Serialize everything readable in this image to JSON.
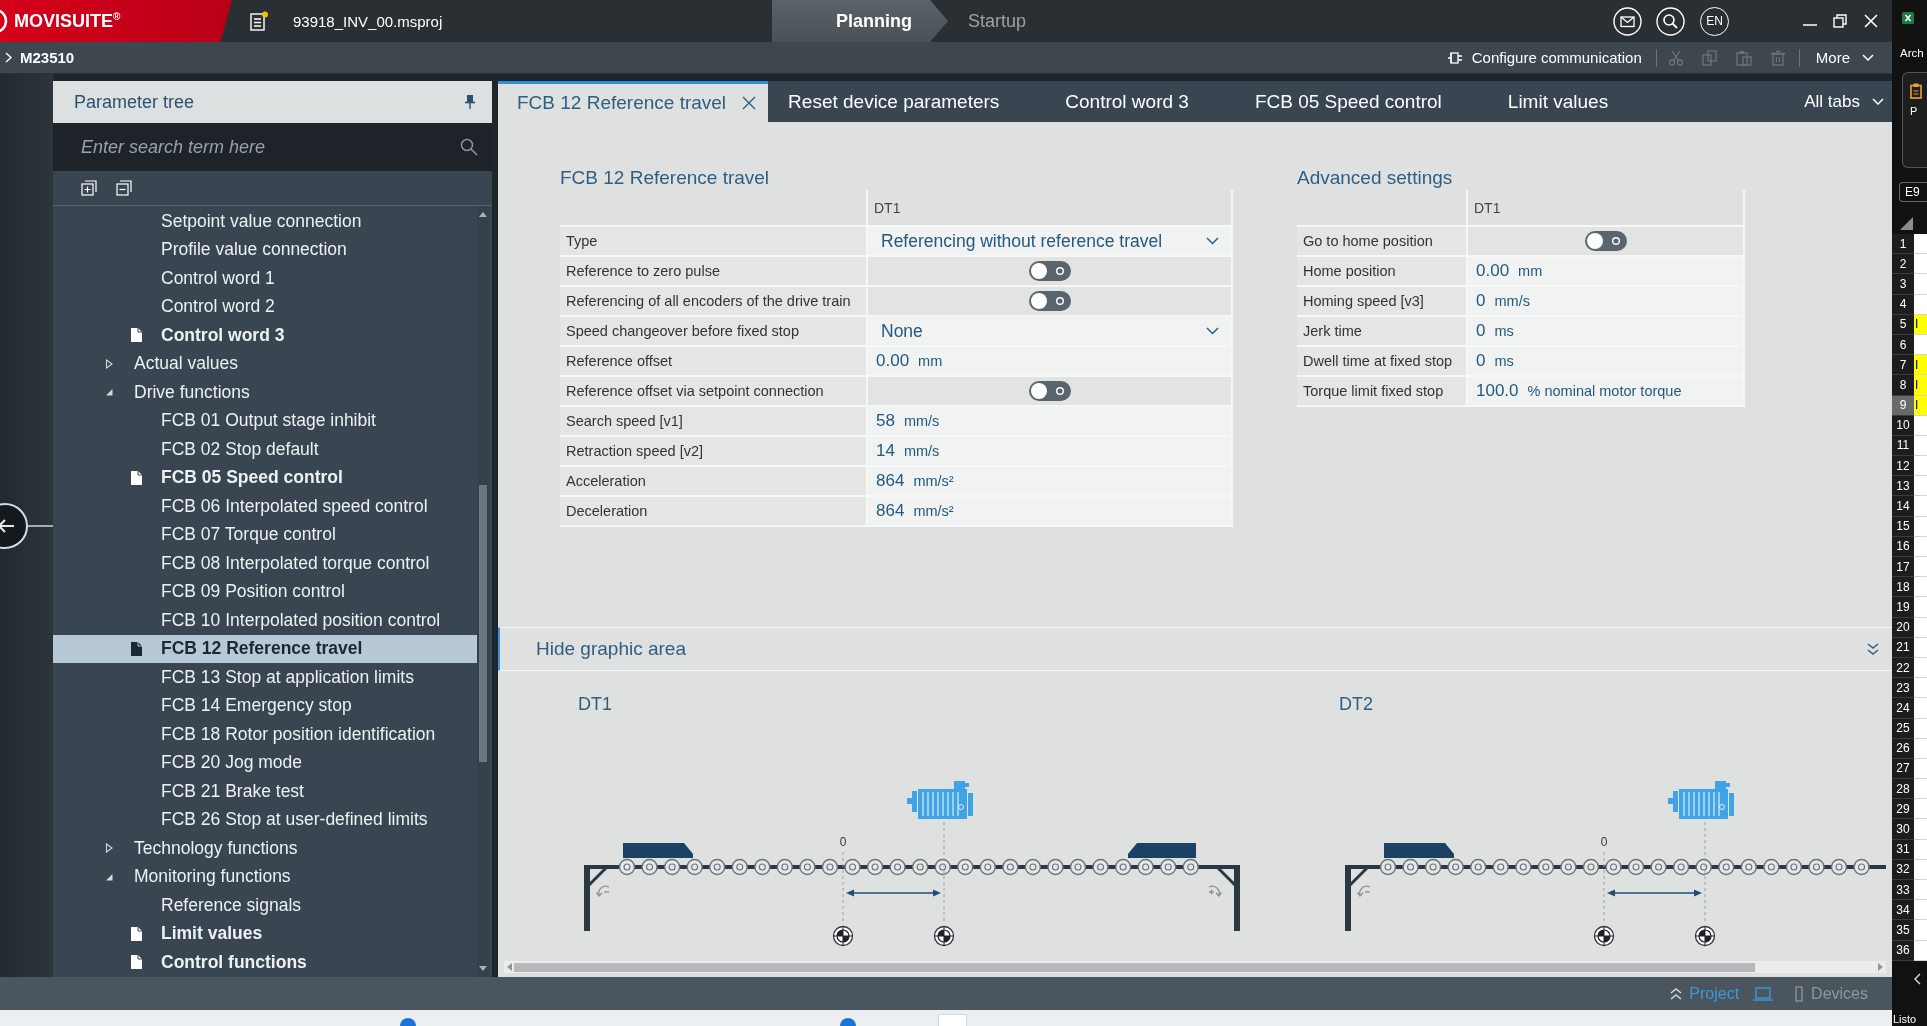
{
  "app_bar": {
    "brand": "MOVISUITE$^{®}$",
    "project_file": "93918_INV_00.msproj",
    "workflow_steps": [
      {
        "label": "Planning",
        "selected": true
      },
      {
        "label": "Startup",
        "selected": false
      }
    ],
    "language": "EN"
  },
  "device_bar": {
    "device": "M23510",
    "configure": "Configure communication",
    "edit_tools": [
      {
        "kind": "cut",
        "disabled": true
      },
      {
        "kind": "copy",
        "disabled": true
      },
      {
        "kind": "paste",
        "disabled": true
      },
      {
        "kind": "delete",
        "disabled": true
      }
    ],
    "more": "More"
  },
  "parameter_tree": {
    "title": "Parameter tree",
    "search": {
      "placeholder": "Enter search term here"
    },
    "items": [
      {
        "children": [
          {
            "label": "Setpoint value connection",
            "modified": false,
            "selected": false
          },
          {
            "label": "Profile value connection",
            "modified": false,
            "selected": false
          },
          {
            "label": "Control word 1",
            "modified": false,
            "selected": false
          },
          {
            "label": "Control word 2",
            "modified": false,
            "selected": false
          },
          {
            "label": "Control word 3",
            "modified": true,
            "selected": false
          }
        ]
      },
      {
        "label": "Actual values",
        "expanded": false,
        "selected": false
      },
      {
        "label": "Drive functions",
        "expanded": true,
        "selected": false,
        "children": [
          {
            "label": "FCB 01 Output stage inhibit",
            "modified": false,
            "selected": false
          },
          {
            "label": "FCB 02 Stop default",
            "modified": false,
            "selected": false
          },
          {
            "label": "FCB 05 Speed control",
            "modified": true,
            "selected": false
          },
          {
            "label": "FCB 06 Interpolated speed control",
            "modified": false,
            "selected": false
          },
          {
            "label": "FCB 07 Torque control",
            "modified": false,
            "selected": false
          },
          {
            "label": "FCB 08 Interpolated torque control",
            "modified": false,
            "selected": false
          },
          {
            "label": "FCB 09 Position control",
            "modified": false,
            "selected": false
          },
          {
            "label": "FCB 10 Interpolated position control",
            "modified": false,
            "selected": false
          },
          {
            "label": "FCB 12 Reference travel",
            "modified": true,
            "selected": true
          },
          {
            "label": "FCB 13 Stop at application limits",
            "modified": false,
            "selected": false
          },
          {
            "label": "FCB 14 Emergency stop",
            "modified": false,
            "selected": false
          },
          {
            "label": "FCB 18 Rotor position identification",
            "modified": false,
            "selected": false
          },
          {
            "label": "FCB 20 Jog mode",
            "modified": false,
            "selected": false
          },
          {
            "label": "FCB 21 Brake test",
            "modified": false,
            "selected": false
          },
          {
            "label": "FCB 26 Stop at user-defined limits",
            "modified": false,
            "selected": false
          }
        ]
      },
      {
        "label": "Technology functions",
        "expanded": false,
        "selected": false
      },
      {
        "label": "Monitoring functions",
        "expanded": true,
        "selected": false,
        "children": [
          {
            "label": "Reference signals",
            "modified": false,
            "selected": false
          },
          {
            "label": "Limit values",
            "modified": true,
            "selected": false
          },
          {
            "label": "Control functions",
            "modified": true,
            "selected": false
          }
        ]
      }
    ]
  },
  "tabs": [
    {
      "label": "FCB 12 Reference travel",
      "selected": true
    },
    {
      "label": "Reset device parameters",
      "selected": false
    },
    {
      "label": "Control word 3",
      "selected": false
    },
    {
      "label": "FCB 05 Speed control",
      "selected": false
    },
    {
      "label": "Limit values",
      "selected": false
    }
  ],
  "all_tabs": "All tabs",
  "sections": [
    {
      "title": "FCB 12 Reference travel",
      "column": "DT1",
      "rows": [
        {
          "label": "Type",
          "kind": "dropdown",
          "value": "Referencing without reference travel"
        },
        {
          "label": "Reference to zero pulse",
          "kind": "toggle",
          "on": false
        },
        {
          "label": "Referencing of all encoders of the drive train",
          "kind": "toggle",
          "on": false
        },
        {
          "label": "Speed changeover before fixed stop",
          "kind": "dropdown",
          "value": "None"
        },
        {
          "label": "Reference offset",
          "kind": "number",
          "value": "0.00",
          "unit": "mm"
        },
        {
          "label": "Reference offset via setpoint connection",
          "kind": "toggle",
          "on": false
        },
        {
          "label": "Search speed [v1]",
          "kind": "number",
          "value": "58",
          "unit": "mm/s"
        },
        {
          "label": "Retraction speed [v2]",
          "kind": "number",
          "value": "14",
          "unit": "mm/s"
        },
        {
          "label": "Acceleration",
          "kind": "number",
          "value": "864",
          "unit": "mm/s²"
        },
        {
          "label": "Deceleration",
          "kind": "number",
          "value": "864",
          "unit": "mm/s²"
        }
      ]
    },
    {
      "title": "Advanced settings",
      "column": "DT1",
      "rows": [
        {
          "label": "Go to home position",
          "kind": "toggle",
          "on": false
        },
        {
          "label": "Home position",
          "kind": "number",
          "value": "0.00",
          "unit": "mm"
        },
        {
          "label": "Homing speed [v3]",
          "kind": "number",
          "value": "0",
          "unit": "mm/s"
        },
        {
          "label": "Jerk time",
          "kind": "number",
          "value": "0",
          "unit": "ms"
        },
        {
          "label": "Dwell time at fixed stop",
          "kind": "number",
          "value": "0",
          "unit": "ms"
        },
        {
          "label": "Torque limit fixed stop",
          "kind": "number",
          "value": "100.0",
          "unit": "% nominal motor torque"
        }
      ]
    }
  ],
  "graphic_area": {
    "toggle": "Hide graphic area",
    "drives": [
      {
        "label": "DT1",
        "zero_label": "0"
      },
      {
        "label": "DT2",
        "zero_label": "0"
      }
    ]
  },
  "status_bar": {
    "views": [
      {
        "label": "Project",
        "selected": true
      },
      {
        "label": "Devices",
        "selected": false
      }
    ]
  },
  "spreadsheet": {
    "title": "Arch",
    "ribbon_label": "P",
    "name_box": "E9",
    "rows": [
      {
        "number": "1",
        "selected": false,
        "highlighted": false
      },
      {
        "number": "2",
        "selected": false,
        "highlighted": false
      },
      {
        "number": "3",
        "selected": false,
        "highlighted": false
      },
      {
        "number": "4",
        "selected": false,
        "highlighted": false
      },
      {
        "number": "5",
        "cell": "I",
        "selected": false,
        "highlighted": true
      },
      {
        "number": "6",
        "selected": false,
        "highlighted": false
      },
      {
        "number": "7",
        "cell": "I",
        "selected": false,
        "highlighted": true
      },
      {
        "number": "8",
        "cell": "I",
        "selected": false,
        "highlighted": true
      },
      {
        "number": "9",
        "cell": "I",
        "selected": true,
        "highlighted": true
      },
      {
        "number": "10",
        "selected": false,
        "highlighted": false
      },
      {
        "number": "11",
        "selected": false,
        "highlighted": false
      },
      {
        "number": "12",
        "selected": false,
        "highlighted": false
      },
      {
        "number": "13",
        "selected": false,
        "highlighted": false
      },
      {
        "number": "14",
        "selected": false,
        "highlighted": false
      },
      {
        "number": "15",
        "selected": false,
        "highlighted": false
      },
      {
        "number": "16",
        "selected": false,
        "highlighted": false
      },
      {
        "number": "17",
        "selected": false,
        "highlighted": false
      },
      {
        "number": "18",
        "selected": false,
        "highlighted": false
      },
      {
        "number": "19",
        "selected": false,
        "highlighted": false
      },
      {
        "number": "20",
        "selected": false,
        "highlighted": false
      },
      {
        "number": "21",
        "selected": false,
        "highlighted": false
      },
      {
        "number": "22",
        "selected": false,
        "highlighted": false
      },
      {
        "number": "23",
        "selected": false,
        "highlighted": false
      },
      {
        "number": "24",
        "selected": false,
        "highlighted": false
      },
      {
        "number": "25",
        "selected": false,
        "highlighted": false
      },
      {
        "number": "26",
        "selected": false,
        "highlighted": false
      },
      {
        "number": "27",
        "selected": false,
        "highlighted": false
      },
      {
        "number": "28",
        "selected": false,
        "highlighted": false
      },
      {
        "number": "29",
        "selected": false,
        "highlighted": false
      },
      {
        "number": "30",
        "selected": false,
        "highlighted": false
      },
      {
        "number": "31",
        "selected": false,
        "highlighted": false
      },
      {
        "number": "32",
        "selected": false,
        "highlighted": false
      },
      {
        "number": "33",
        "selected": false,
        "highlighted": false
      },
      {
        "number": "34",
        "selected": false,
        "highlighted": false
      },
      {
        "number": "35",
        "selected": false,
        "highlighted": false
      },
      {
        "number": "36",
        "selected": false,
        "highlighted": false
      }
    ],
    "status": "Listo"
  }
}
